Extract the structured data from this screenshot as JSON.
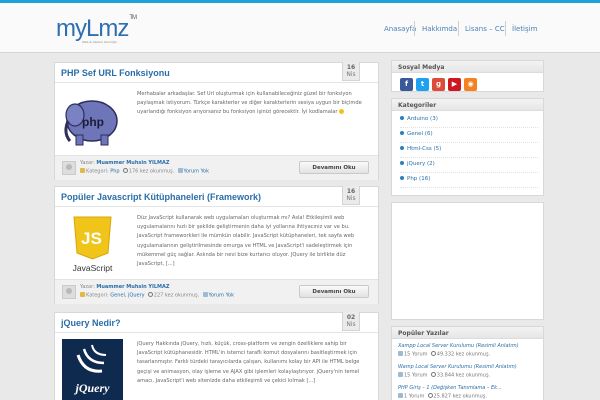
{
  "site": {
    "logo": "myLmz",
    "logo_mark": "TM",
    "tagline": "Web & Yazılım Günlüğü",
    "accent_color": "#1ea1d8",
    "link_color": "#2a6ea8"
  },
  "nav": {
    "items": [
      "Anasayfa",
      "Hakkımda",
      "Lisans – CC",
      "İletişim"
    ]
  },
  "posts": [
    {
      "title": "PHP Sef URL Fonksiyonu",
      "date_day": "16",
      "date_month": "Nis",
      "thumb": "php-elephant",
      "thumb_label": "php",
      "excerpt": "Merhabalar arkadaşlar.   Sef Url oluşturmak için kullanabileceğiniz güzel bir fonksiyon paylaşmak istiyorum. Türkçe karakterler ve diğer karakterlerin sesiyа uygun bir biçimde uyarlandığı fonksiyon arıyorsanız bu fonksiyon işinizi görecektir.   İyi kodlamalar",
      "author_label": "Yazar:",
      "author": "Muammer Muhsin YILMAZ",
      "category_label": "Kategori:",
      "category": "Php",
      "views": "176 kez okunmuş.",
      "comments": "Yorum Yok",
      "read_more": "Devamını Oku"
    },
    {
      "title": "Popüler Javascript Kütüphaneleri (Framework)",
      "date_day": "16",
      "date_month": "Nis",
      "thumb": "javascript-logo",
      "thumb_label": "JavaScript",
      "excerpt": "Düz JavaScript kullanarak web uygulamaları oluşturmak mı? Asla! Etkileşimli web uygulamalarını hızlı bir şekilde geliştirmenin daha iyi yollarına ihtiyacınız var ve bu. JavaScript frameworkleri ile mümkün olabilir. JavaScript kütüphaneleri, tek sayfa web uygulamalarının geliştirilmesinde omurga ve HTML ve JavaScript'i sadeleştirmek için mükemmel güç sağlar. Aslında bir nevi bize kurtarıcı oluyor. JQuery ile birlikte düz JavaScript, [...]",
      "author_label": "Yazar:",
      "author": "Muammer Muhsin YILMAZ",
      "category_label": "Kategori:",
      "category": "Genel, jQuery",
      "views": "227 kez okunmuş.",
      "comments": "Yorum Yok",
      "read_more": "Devamını Oku"
    },
    {
      "title": "jQuery Nedir?",
      "date_day": "02",
      "date_month": "Nis",
      "thumb": "jquery-logo",
      "thumb_label": "jQuery",
      "excerpt": "jQuery Hakkında   jQuery, hızlı, küçük, cross-platform ve zengin özelliklere sahip bir JavaScript kütüphanesidir. HTML'in istemci taraflı komut dosyalarını basitleştirmek için tasarlanmıştır. Farklı türdeki tarayıcılarda çalışan, kullanımı kolay bir API ile HTML belge geçişi ve animasyon, olay işleme ve AJAX gibi işlemleri kolaylaştırıyor.   jQuery'nin temel amacı, JavaScript'i web sitenizde daha etkileşimli ve çekici kılmak [...]"
    }
  ],
  "sidebar": {
    "social": {
      "title": "Sosyal Medya",
      "icons": [
        {
          "name": "facebook-icon",
          "glyph": "f",
          "color": "#3b5998"
        },
        {
          "name": "twitter-icon",
          "glyph": "t",
          "color": "#1da1f2"
        },
        {
          "name": "google-plus-icon",
          "glyph": "g",
          "color": "#dd4b39"
        },
        {
          "name": "youtube-icon",
          "glyph": "▶",
          "color": "#cc181e"
        },
        {
          "name": "rss-icon",
          "glyph": "◉",
          "color": "#f58220"
        }
      ]
    },
    "categories": {
      "title": "Kategoriler",
      "items": [
        {
          "name": "Arduino",
          "count": "(3)"
        },
        {
          "name": "Genel",
          "count": "(6)"
        },
        {
          "name": "Html-Css",
          "count": "(5)"
        },
        {
          "name": "jQuery",
          "count": "(2)"
        },
        {
          "name": "Php",
          "count": "(16)"
        }
      ]
    },
    "popular": {
      "title": "Popüler Yazılar",
      "items": [
        {
          "title": "Xampp Local Server Kurulumu (Resimli Anlatım)",
          "comments": "15 Yorum",
          "views": "49.332 kez okunmuş."
        },
        {
          "title": "Wamp Local Server Kurulumu (Resimli Anlatım)",
          "comments": "15 Yorum",
          "views": "33.844 kez okunmuş."
        },
        {
          "title": "PHP Giriş – 1 (Değişken Tanımlama – Ek...",
          "comments": "1 Yorum",
          "views": "25.827 kez okunmuş."
        }
      ]
    }
  }
}
